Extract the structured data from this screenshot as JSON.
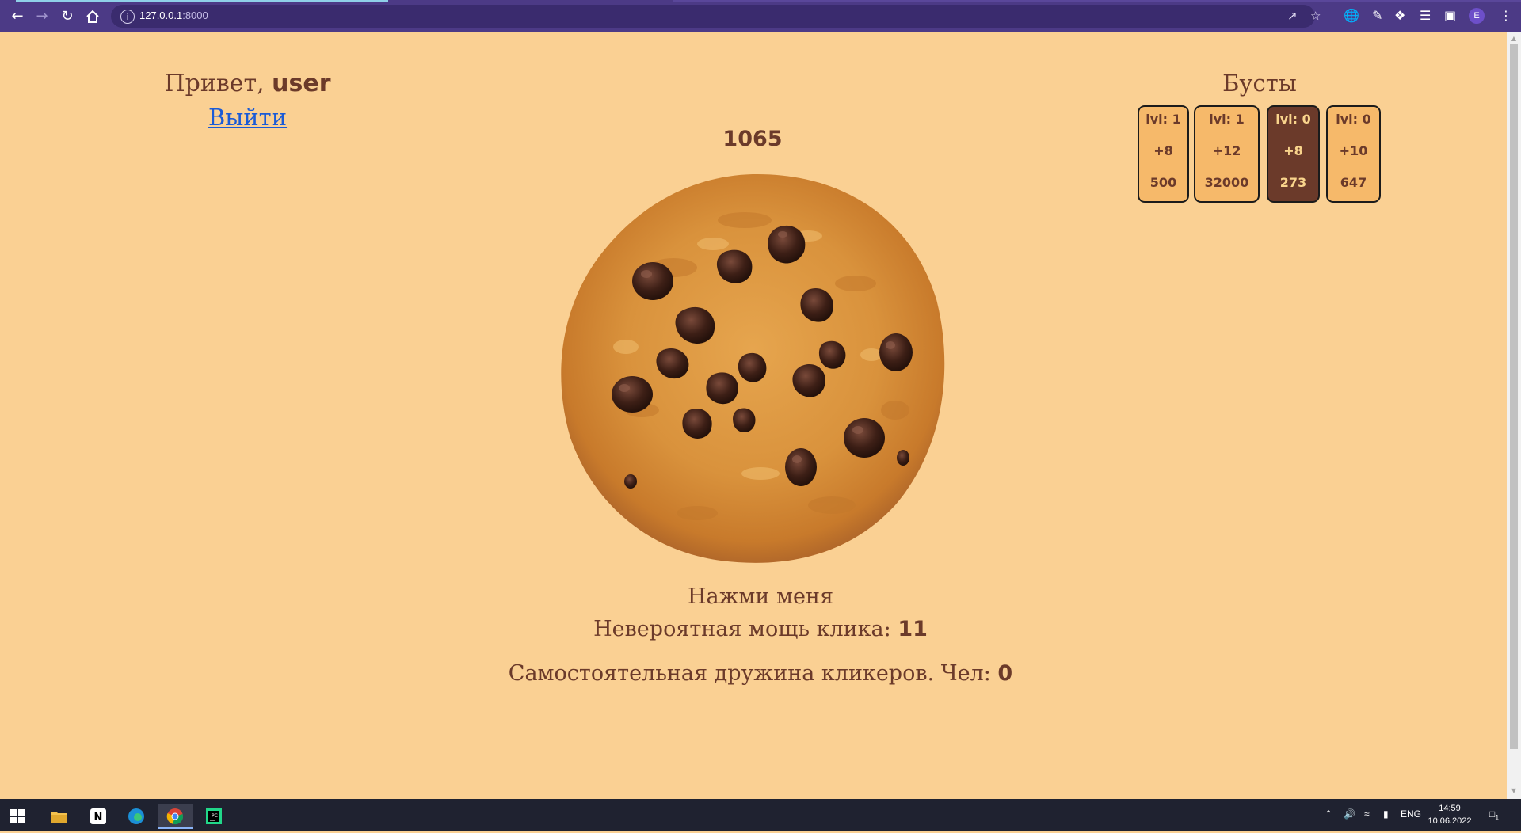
{
  "browser": {
    "url_host": "127.0.0.1",
    "url_port": ":8000",
    "profile_initial": "E"
  },
  "page": {
    "greeting_prefix": "Привет,",
    "username": "user",
    "logout": "Выйти",
    "score": "1065",
    "click_me": "Нажми меня",
    "click_power_label": "Невероятная мощь клика:",
    "click_power_value": "11",
    "auto_clickers_label": "Самостоятельная дружина кликеров. Чел:",
    "auto_clickers_value": "0"
  },
  "boosts": {
    "title": "Бусты",
    "items": [
      {
        "level": "lvl: 1",
        "add": "+8",
        "price": "500",
        "active": false
      },
      {
        "level": "lvl: 1",
        "add": "+12",
        "price": "32000",
        "active": false
      },
      {
        "level": "lvl: 0",
        "add": "+8",
        "price": "273",
        "active": true
      },
      {
        "level": "lvl: 0",
        "add": "+10",
        "price": "647",
        "active": false
      }
    ]
  },
  "taskbar": {
    "language": "ENG",
    "time": "14:59",
    "date": "10.06.2022",
    "notification_count": "1"
  },
  "colors": {
    "page_bg": "#fad093",
    "text_brown": "#6b3a2a",
    "boost_bg": "#f6b96a",
    "boost_active_bg": "#6b3a2a",
    "browser_bar": "#4c3a86",
    "link": "#1a5bd7"
  }
}
